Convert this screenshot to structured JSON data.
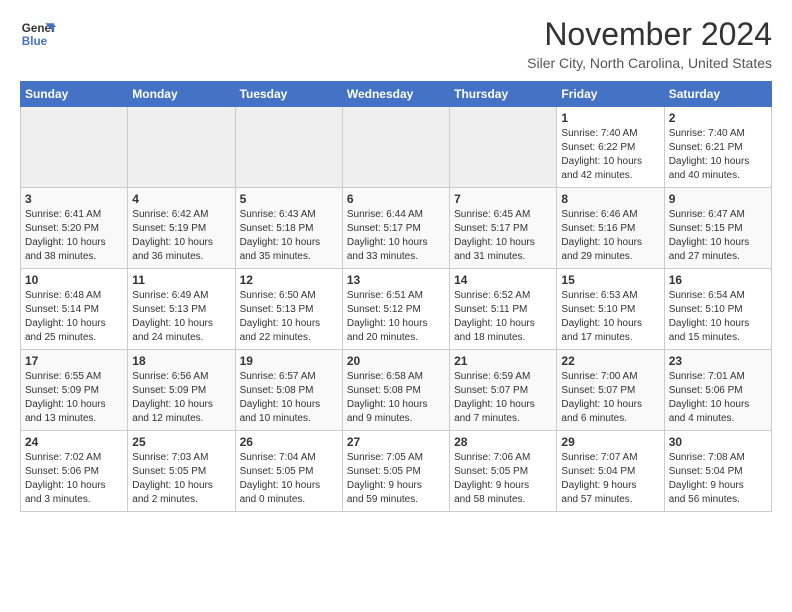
{
  "header": {
    "logo_line1": "General",
    "logo_line2": "Blue",
    "month": "November 2024",
    "location": "Siler City, North Carolina, United States"
  },
  "days_of_week": [
    "Sunday",
    "Monday",
    "Tuesday",
    "Wednesday",
    "Thursday",
    "Friday",
    "Saturday"
  ],
  "weeks": [
    [
      {
        "day": "",
        "info": "",
        "empty": true
      },
      {
        "day": "",
        "info": "",
        "empty": true
      },
      {
        "day": "",
        "info": "",
        "empty": true
      },
      {
        "day": "",
        "info": "",
        "empty": true
      },
      {
        "day": "",
        "info": "",
        "empty": true
      },
      {
        "day": "1",
        "info": "Sunrise: 7:40 AM\nSunset: 6:22 PM\nDaylight: 10 hours\nand 42 minutes."
      },
      {
        "day": "2",
        "info": "Sunrise: 7:40 AM\nSunset: 6:21 PM\nDaylight: 10 hours\nand 40 minutes."
      }
    ],
    [
      {
        "day": "3",
        "info": "Sunrise: 6:41 AM\nSunset: 5:20 PM\nDaylight: 10 hours\nand 38 minutes."
      },
      {
        "day": "4",
        "info": "Sunrise: 6:42 AM\nSunset: 5:19 PM\nDaylight: 10 hours\nand 36 minutes."
      },
      {
        "day": "5",
        "info": "Sunrise: 6:43 AM\nSunset: 5:18 PM\nDaylight: 10 hours\nand 35 minutes."
      },
      {
        "day": "6",
        "info": "Sunrise: 6:44 AM\nSunset: 5:17 PM\nDaylight: 10 hours\nand 33 minutes."
      },
      {
        "day": "7",
        "info": "Sunrise: 6:45 AM\nSunset: 5:17 PM\nDaylight: 10 hours\nand 31 minutes."
      },
      {
        "day": "8",
        "info": "Sunrise: 6:46 AM\nSunset: 5:16 PM\nDaylight: 10 hours\nand 29 minutes."
      },
      {
        "day": "9",
        "info": "Sunrise: 6:47 AM\nSunset: 5:15 PM\nDaylight: 10 hours\nand 27 minutes."
      }
    ],
    [
      {
        "day": "10",
        "info": "Sunrise: 6:48 AM\nSunset: 5:14 PM\nDaylight: 10 hours\nand 25 minutes."
      },
      {
        "day": "11",
        "info": "Sunrise: 6:49 AM\nSunset: 5:13 PM\nDaylight: 10 hours\nand 24 minutes."
      },
      {
        "day": "12",
        "info": "Sunrise: 6:50 AM\nSunset: 5:13 PM\nDaylight: 10 hours\nand 22 minutes."
      },
      {
        "day": "13",
        "info": "Sunrise: 6:51 AM\nSunset: 5:12 PM\nDaylight: 10 hours\nand 20 minutes."
      },
      {
        "day": "14",
        "info": "Sunrise: 6:52 AM\nSunset: 5:11 PM\nDaylight: 10 hours\nand 18 minutes."
      },
      {
        "day": "15",
        "info": "Sunrise: 6:53 AM\nSunset: 5:10 PM\nDaylight: 10 hours\nand 17 minutes."
      },
      {
        "day": "16",
        "info": "Sunrise: 6:54 AM\nSunset: 5:10 PM\nDaylight: 10 hours\nand 15 minutes."
      }
    ],
    [
      {
        "day": "17",
        "info": "Sunrise: 6:55 AM\nSunset: 5:09 PM\nDaylight: 10 hours\nand 13 minutes."
      },
      {
        "day": "18",
        "info": "Sunrise: 6:56 AM\nSunset: 5:09 PM\nDaylight: 10 hours\nand 12 minutes."
      },
      {
        "day": "19",
        "info": "Sunrise: 6:57 AM\nSunset: 5:08 PM\nDaylight: 10 hours\nand 10 minutes."
      },
      {
        "day": "20",
        "info": "Sunrise: 6:58 AM\nSunset: 5:08 PM\nDaylight: 10 hours\nand 9 minutes."
      },
      {
        "day": "21",
        "info": "Sunrise: 6:59 AM\nSunset: 5:07 PM\nDaylight: 10 hours\nand 7 minutes."
      },
      {
        "day": "22",
        "info": "Sunrise: 7:00 AM\nSunset: 5:07 PM\nDaylight: 10 hours\nand 6 minutes."
      },
      {
        "day": "23",
        "info": "Sunrise: 7:01 AM\nSunset: 5:06 PM\nDaylight: 10 hours\nand 4 minutes."
      }
    ],
    [
      {
        "day": "24",
        "info": "Sunrise: 7:02 AM\nSunset: 5:06 PM\nDaylight: 10 hours\nand 3 minutes."
      },
      {
        "day": "25",
        "info": "Sunrise: 7:03 AM\nSunset: 5:05 PM\nDaylight: 10 hours\nand 2 minutes."
      },
      {
        "day": "26",
        "info": "Sunrise: 7:04 AM\nSunset: 5:05 PM\nDaylight: 10 hours\nand 0 minutes."
      },
      {
        "day": "27",
        "info": "Sunrise: 7:05 AM\nSunset: 5:05 PM\nDaylight: 9 hours\nand 59 minutes."
      },
      {
        "day": "28",
        "info": "Sunrise: 7:06 AM\nSunset: 5:05 PM\nDaylight: 9 hours\nand 58 minutes."
      },
      {
        "day": "29",
        "info": "Sunrise: 7:07 AM\nSunset: 5:04 PM\nDaylight: 9 hours\nand 57 minutes."
      },
      {
        "day": "30",
        "info": "Sunrise: 7:08 AM\nSunset: 5:04 PM\nDaylight: 9 hours\nand 56 minutes."
      }
    ]
  ]
}
